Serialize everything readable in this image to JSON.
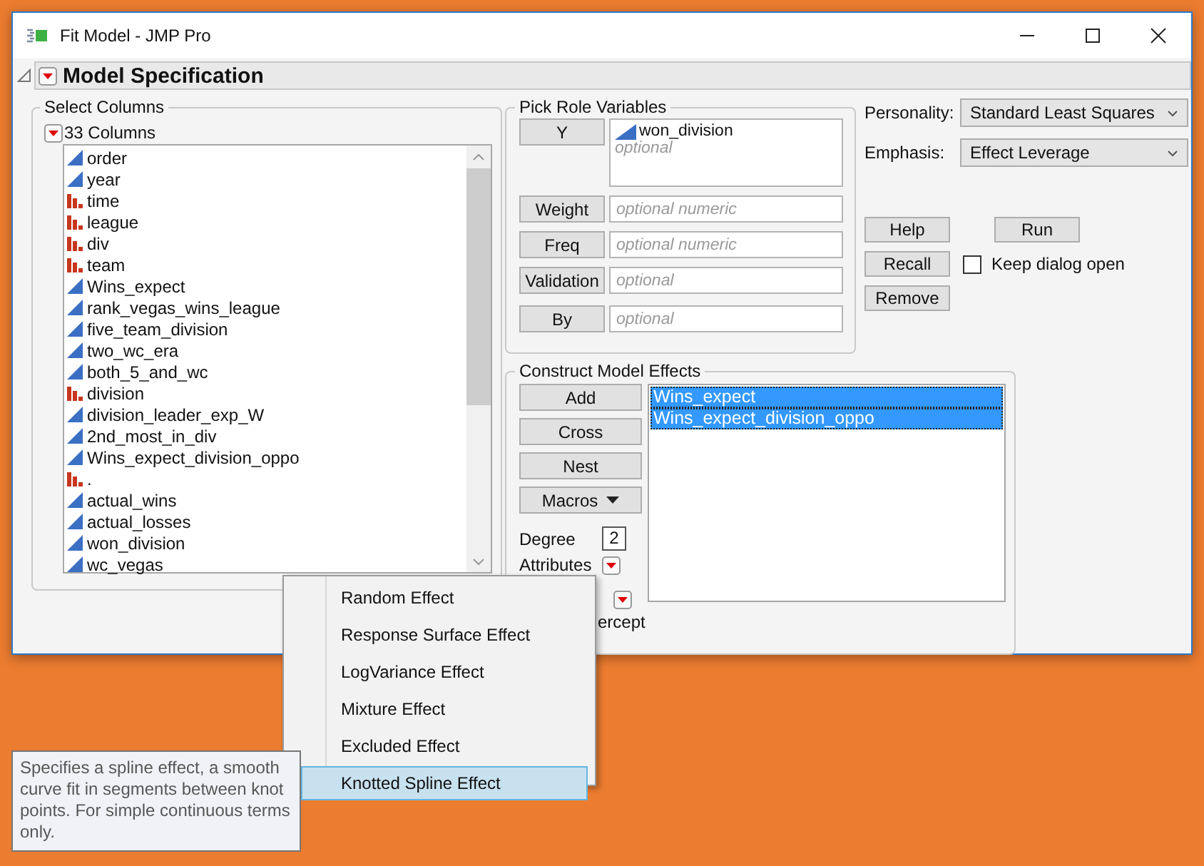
{
  "window": {
    "title": "Fit Model - JMP Pro"
  },
  "section": {
    "title": "Model Specification",
    "expanded": true
  },
  "select_columns": {
    "title": "Select Columns",
    "count": "33 Columns",
    "columns": [
      {
        "name": "order",
        "kind": "continuous"
      },
      {
        "name": "year",
        "kind": "continuous"
      },
      {
        "name": "time",
        "kind": "nominal"
      },
      {
        "name": "league",
        "kind": "nominal"
      },
      {
        "name": "div",
        "kind": "nominal"
      },
      {
        "name": "team",
        "kind": "nominal"
      },
      {
        "name": "Wins_expect",
        "kind": "continuous"
      },
      {
        "name": "rank_vegas_wins_league",
        "kind": "continuous"
      },
      {
        "name": "five_team_division",
        "kind": "continuous"
      },
      {
        "name": "two_wc_era",
        "kind": "continuous"
      },
      {
        "name": "both_5_and_wc",
        "kind": "continuous"
      },
      {
        "name": "division",
        "kind": "nominal"
      },
      {
        "name": "division_leader_exp_W",
        "kind": "continuous"
      },
      {
        "name": "2nd_most_in_div",
        "kind": "continuous"
      },
      {
        "name": "Wins_expect_division_oppo",
        "kind": "continuous"
      },
      {
        "name": ".",
        "kind": "nominal"
      },
      {
        "name": "actual_wins",
        "kind": "continuous"
      },
      {
        "name": "actual_losses",
        "kind": "continuous"
      },
      {
        "name": "won_division",
        "kind": "continuous"
      },
      {
        "name": "wc_vegas",
        "kind": "continuous"
      }
    ]
  },
  "role_variables": {
    "title": "Pick Role Variables",
    "roles": [
      {
        "label": "Y",
        "value": "won_division",
        "placeholder": "optional"
      },
      {
        "label": "Weight",
        "placeholder": "optional numeric"
      },
      {
        "label": "Freq",
        "placeholder": "optional numeric"
      },
      {
        "label": "Validation",
        "placeholder": "optional"
      },
      {
        "label": "By",
        "placeholder": "optional"
      }
    ]
  },
  "personality": {
    "label": "Personality:",
    "value": "Standard Least Squares"
  },
  "emphasis": {
    "label": "Emphasis:",
    "value": "Effect Leverage"
  },
  "actions": {
    "help": "Help",
    "run": "Run",
    "recall": "Recall",
    "remove": "Remove"
  },
  "keep_dialog_open": {
    "label": "Keep dialog open",
    "checked": false
  },
  "construct": {
    "title": "Construct Model Effects",
    "buttons": [
      {
        "label": "Add",
        "kind": "plain"
      },
      {
        "label": "Cross",
        "kind": "plain"
      },
      {
        "label": "Nest",
        "kind": "plain"
      },
      {
        "label": "Macros",
        "kind": "dropdown"
      }
    ],
    "degree": {
      "label": "Degree",
      "value": "2"
    },
    "attributes_label": "Attributes",
    "intercept_fragment": "ercept",
    "effects": [
      {
        "name": "Wins_expect",
        "selected": true
      },
      {
        "name": "Wins_expect_division_oppo",
        "selected": true
      }
    ]
  },
  "menu": {
    "items": [
      {
        "label": "Random Effect",
        "selected": false
      },
      {
        "label": "Response Surface Effect",
        "selected": false
      },
      {
        "label": "LogVariance Effect",
        "selected": false
      },
      {
        "label": "Mixture Effect",
        "selected": false
      },
      {
        "label": "Excluded Effect",
        "selected": false
      },
      {
        "label": "Knotted Spline Effect",
        "selected": true
      }
    ]
  },
  "tooltip": "Specifies a spline effect, a smooth curve fit in segments between knot points. For simple continuous terms only."
}
